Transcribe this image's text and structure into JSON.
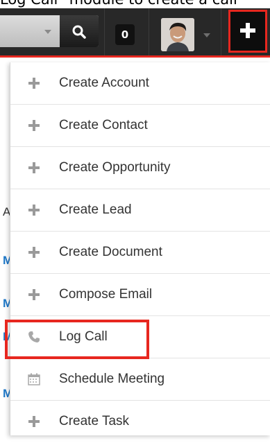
{
  "caption": "Log Call\" module to create a call",
  "search": {
    "placeholder": ""
  },
  "notifications": {
    "count": "0"
  },
  "menu": {
    "items": [
      {
        "label": "Create Account",
        "icon": "plus-icon"
      },
      {
        "label": "Create Contact",
        "icon": "plus-icon"
      },
      {
        "label": "Create Opportunity",
        "icon": "plus-icon"
      },
      {
        "label": "Create Lead",
        "icon": "plus-icon"
      },
      {
        "label": "Create Document",
        "icon": "plus-icon"
      },
      {
        "label": "Compose Email",
        "icon": "plus-icon"
      },
      {
        "label": "Log Call",
        "icon": "phone-icon"
      },
      {
        "label": "Schedule Meeting",
        "icon": "calendar-icon"
      },
      {
        "label": "Create Task",
        "icon": "plus-icon"
      }
    ]
  },
  "background_letters": [
    "A",
    "M",
    "M",
    "M",
    "M"
  ],
  "colors": {
    "toolbar": "#282828",
    "accent_red": "#e7271f",
    "link_blue": "#1f78c8"
  }
}
